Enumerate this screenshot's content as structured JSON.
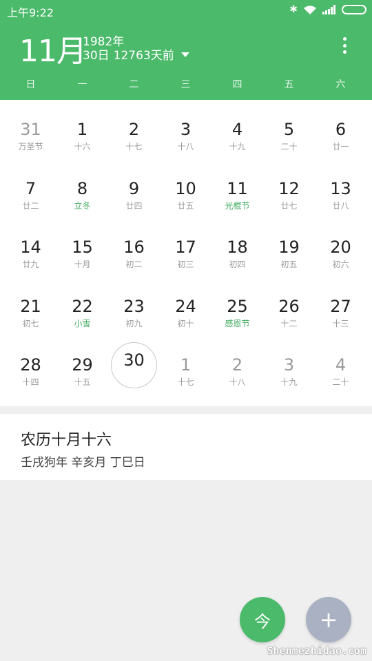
{
  "status_bar": {
    "time": "上午9:22",
    "icons": [
      "bluetooth-icon",
      "wifi-icon",
      "signal-icon",
      "battery-icon"
    ]
  },
  "header": {
    "month": "11月",
    "year": "1982年",
    "day": "30日",
    "days_ago": "12763天前",
    "accent_color": "#4bba6b"
  },
  "weekdays": [
    "日",
    "一",
    "二",
    "三",
    "四",
    "五",
    "六"
  ],
  "weeks": [
    [
      {
        "num": "31",
        "sub": "万圣节",
        "other": true
      },
      {
        "num": "1",
        "sub": "十六"
      },
      {
        "num": "2",
        "sub": "十七"
      },
      {
        "num": "3",
        "sub": "十八"
      },
      {
        "num": "4",
        "sub": "十九"
      },
      {
        "num": "5",
        "sub": "二十"
      },
      {
        "num": "6",
        "sub": "廿一"
      }
    ],
    [
      {
        "num": "7",
        "sub": "廿二"
      },
      {
        "num": "8",
        "sub": "立冬",
        "festival": true
      },
      {
        "num": "9",
        "sub": "廿四"
      },
      {
        "num": "10",
        "sub": "廿五"
      },
      {
        "num": "11",
        "sub": "光棍节",
        "festival": true
      },
      {
        "num": "12",
        "sub": "廿七"
      },
      {
        "num": "13",
        "sub": "廿八"
      }
    ],
    [
      {
        "num": "14",
        "sub": "廿九"
      },
      {
        "num": "15",
        "sub": "十月"
      },
      {
        "num": "16",
        "sub": "初二"
      },
      {
        "num": "17",
        "sub": "初三"
      },
      {
        "num": "18",
        "sub": "初四"
      },
      {
        "num": "19",
        "sub": "初五"
      },
      {
        "num": "20",
        "sub": "初六"
      }
    ],
    [
      {
        "num": "21",
        "sub": "初七"
      },
      {
        "num": "22",
        "sub": "小雪",
        "festival": true
      },
      {
        "num": "23",
        "sub": "初九"
      },
      {
        "num": "24",
        "sub": "初十"
      },
      {
        "num": "25",
        "sub": "感恩节",
        "festival": true
      },
      {
        "num": "26",
        "sub": "十二"
      },
      {
        "num": "27",
        "sub": "十三"
      }
    ],
    [
      {
        "num": "28",
        "sub": "十四"
      },
      {
        "num": "29",
        "sub": "十五"
      },
      {
        "num": "30",
        "sub": "",
        "today": true
      },
      {
        "num": "1",
        "sub": "十七",
        "other": true
      },
      {
        "num": "2",
        "sub": "十八",
        "other": true
      },
      {
        "num": "3",
        "sub": "十九",
        "other": true
      },
      {
        "num": "4",
        "sub": "二十",
        "other": true
      }
    ]
  ],
  "lunar_card": {
    "title": "农历十月十六",
    "ganzhi": "壬戌狗年 辛亥月 丁巳日"
  },
  "fab": {
    "today_label": "今",
    "add_label": "+"
  },
  "watermark": "Shenmezhidao.com"
}
